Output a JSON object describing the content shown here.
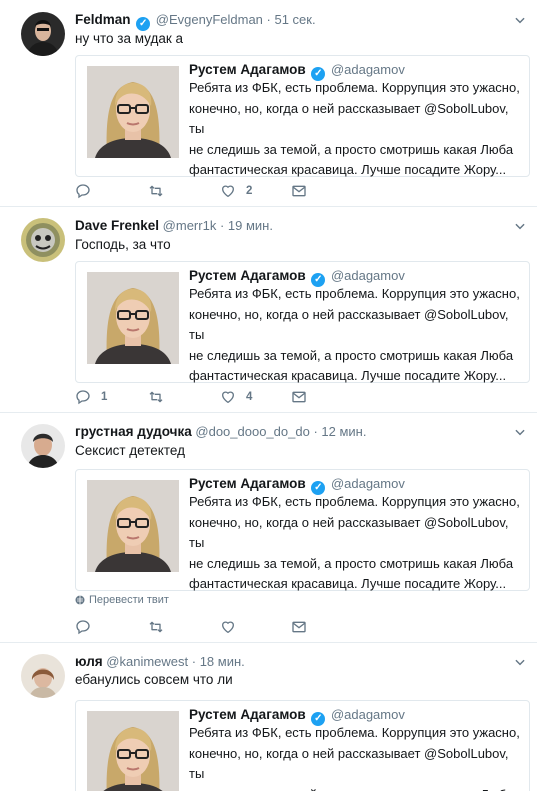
{
  "icons": {
    "verified": "verified-badge-icon",
    "more": "chevron-down-icon",
    "reply": "reply-icon",
    "retweet": "retweet-icon",
    "like": "heart-icon",
    "dm": "envelope-icon",
    "globe": "globe-icon"
  },
  "colors": {
    "accent": "#1da1f2",
    "muted": "#657786",
    "border": "#e6ecf0"
  },
  "quoted": {
    "name": "Рустем Адагамов",
    "handle": "@adagamov",
    "line1": "Ребята из ФБК, есть проблема. Коррупция это ужасно,",
    "line2": "конечно, но, когда о ней рассказывает @SobolLubov, ты",
    "line3": "не следишь за темой, а просто смотришь какая Люба",
    "line4": "фантастическая красавица. Лучше посадите Жору..."
  },
  "tweets": [
    {
      "name": "Feldman",
      "handle": "@EvgenyFeldman",
      "time": "· 51 сек.",
      "text": "ну что за мудак а",
      "reply_count": "",
      "like_count": "2"
    },
    {
      "name": "Dave Frenkel",
      "handle": "@merr1k",
      "time": "· 19 мин.",
      "text": "Господь, за что",
      "reply_count": "1",
      "like_count": "4"
    },
    {
      "name": "грустная дудочка",
      "handle": "@doo_dooo_do_do",
      "time": "· 12 мин.",
      "text": "Сексист детектед",
      "reply_count": "",
      "like_count": "",
      "translate": "Перевести твит"
    },
    {
      "name": "юля",
      "handle": "@kanimewest",
      "time": "· 18 мин.",
      "text": "ебанулись совсем что ли"
    }
  ]
}
